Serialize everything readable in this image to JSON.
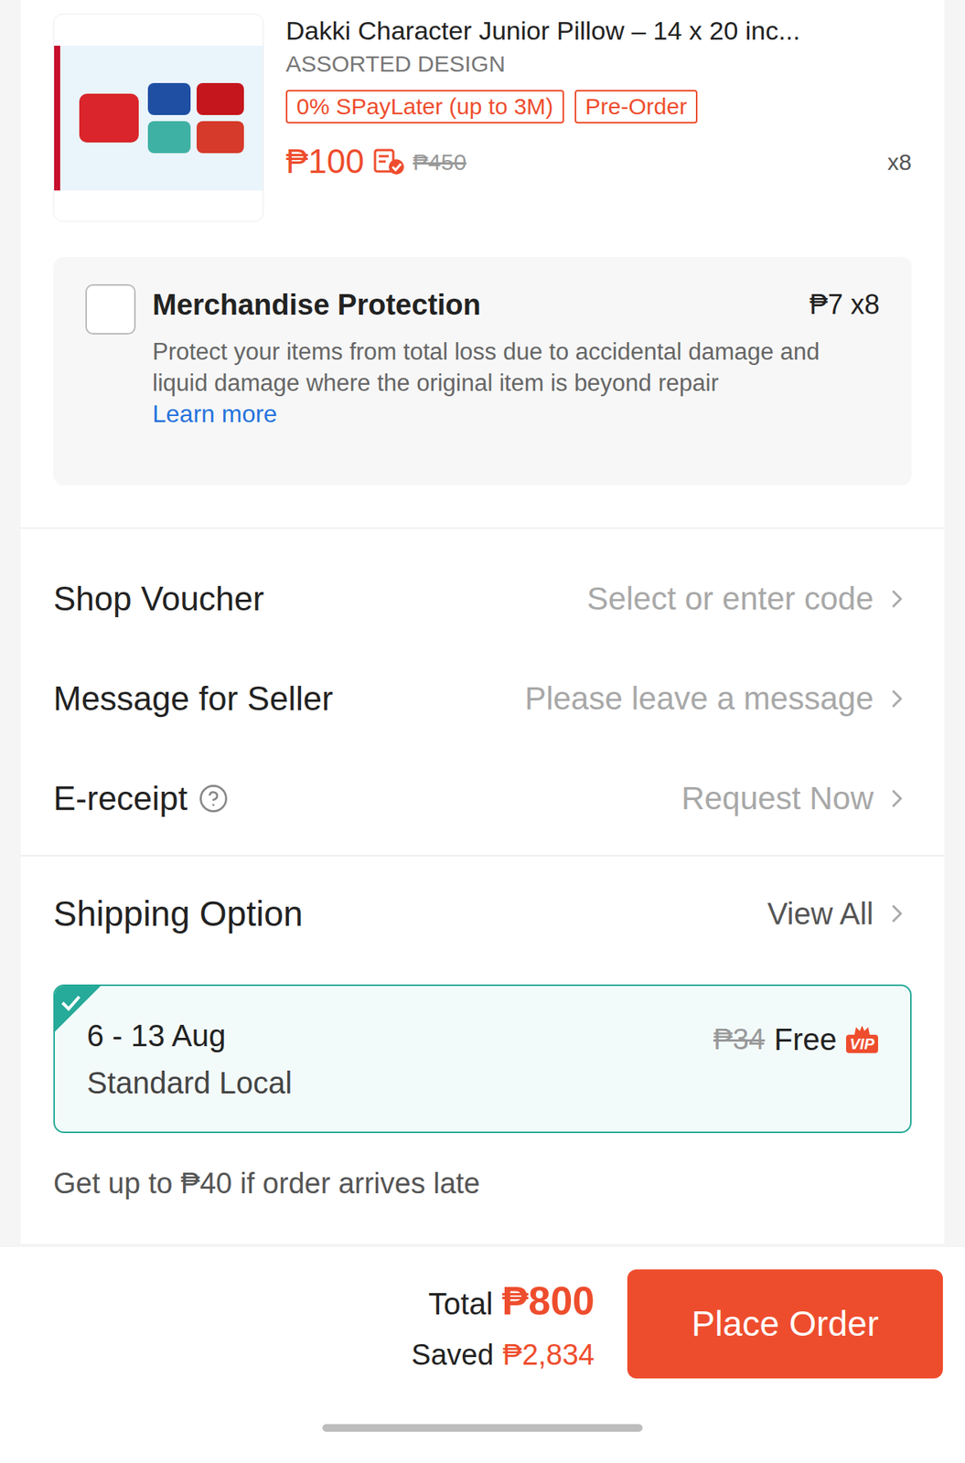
{
  "product": {
    "title": "Dakki Character Junior Pillow – 14 x 20 inc...",
    "variation": "ASSORTED DESIGN",
    "badges": [
      "0% SPayLater (up to 3M)",
      "Pre-Order"
    ],
    "price": "₱100",
    "original_price": "₱450",
    "quantity": "x8"
  },
  "protection": {
    "title": "Merchandise Protection",
    "price": "₱7 x8",
    "description": "Protect your items from total loss due to accidental damage and liquid damage where the original item is beyond repair",
    "link": "Learn more",
    "checked": false
  },
  "rows": [
    {
      "label": "Shop Voucher",
      "value": "Select or enter code",
      "help": false
    },
    {
      "label": "Message for Seller",
      "value": "Please leave a message",
      "help": false
    },
    {
      "label": "E-receipt",
      "value": "Request Now",
      "help": true
    }
  ],
  "shipping": {
    "title": "Shipping Option",
    "view_all": "View All",
    "options": [
      {
        "dates": "6 - 13 Aug",
        "method": "Standard Local",
        "original_fee": "₱34",
        "fee": "Free",
        "badge": "VIP",
        "selected": true
      }
    ],
    "guarantee": "Get up to ₱40 if order arrives late"
  },
  "footer": {
    "total_label": "Total",
    "total": "₱800",
    "saved_label": "Saved",
    "saved": "₱2,834",
    "button": "Place Order"
  }
}
